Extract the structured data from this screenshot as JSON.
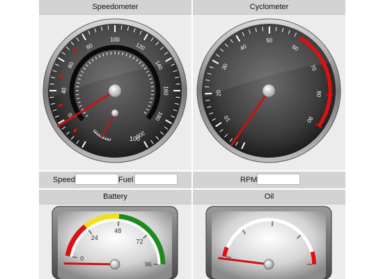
{
  "panels": {
    "speedometer": {
      "title": "Speedometer"
    },
    "cyclometer": {
      "title": "Cyclometer"
    },
    "battery": {
      "title": "Battery"
    },
    "oil": {
      "title": "Oil"
    }
  },
  "controls": {
    "speed_label": "Speed",
    "speed_value": "",
    "fuel_label": "Fuel",
    "fuel_value": "",
    "rpm_label": "RPM",
    "rpm_value": ""
  },
  "gauges": {
    "speedometer": {
      "outer_labels": [
        "0",
        "20",
        "40",
        "60",
        "80",
        "100",
        "120",
        "140",
        "160",
        "180",
        "200"
      ],
      "outer_min": 0,
      "outer_max": 200,
      "needle_value": 20,
      "sub_gauge_label": "100",
      "sub_needle_value": 0.15
    },
    "cyclometer": {
      "labels": [
        "0",
        "10",
        "20",
        "30",
        "40",
        "50",
        "60",
        "70",
        "80",
        "90"
      ],
      "min": 0,
      "max": 90,
      "red_zone_start": 60,
      "needle_value": 5
    },
    "battery": {
      "labels": [
        "0",
        "24",
        "48",
        "72",
        "96"
      ],
      "min": 0,
      "max": 96,
      "needle_value": 0
    },
    "oil": {
      "needle_value": 0.03
    }
  },
  "colors": {
    "header_bg": "#d3d3d3",
    "panel_bg": "#ececec",
    "needle": "#cc1111",
    "zone_red": "#dd1111",
    "zone_yellow": "#f4e01a",
    "zone_green": "#1e8a1e",
    "ring_black": "#0a0a0a"
  }
}
